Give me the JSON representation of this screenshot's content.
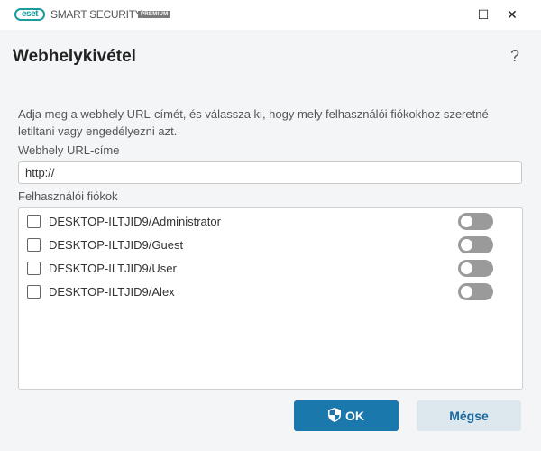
{
  "titlebar": {
    "logo": "eset",
    "product": "SMART SECURITY",
    "edition": "PREMIUM",
    "minimize": "☐",
    "close": "✕",
    "minimize_glyph": "—"
  },
  "dialog": {
    "title": "Webhelykivétel",
    "help": "?",
    "description": "Adja meg a webhely URL-címét, és válassza ki, hogy mely felhasználói fiókokhoz szeretné letiltani vagy engedélyezni azt.",
    "url_label": "Webhely URL-címe",
    "url_value": "http://",
    "accounts_label": "Felhasználói fiókok",
    "accounts": [
      {
        "name": "DESKTOP-ILTJID9/Administrator",
        "checked": false,
        "enabled": false
      },
      {
        "name": "DESKTOP-ILTJID9/Guest",
        "checked": false,
        "enabled": false
      },
      {
        "name": "DESKTOP-ILTJID9/User",
        "checked": false,
        "enabled": false
      },
      {
        "name": "DESKTOP-ILTJID9/Alex",
        "checked": false,
        "enabled": false
      }
    ]
  },
  "buttons": {
    "ok": "OK",
    "cancel": "Mégse"
  }
}
